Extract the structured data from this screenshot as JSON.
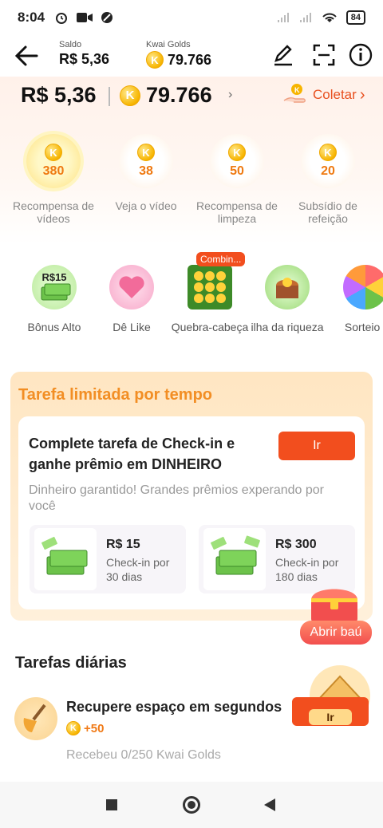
{
  "status_bar": {
    "time": "8:04",
    "battery": "84"
  },
  "header": {
    "saldo_label": "Saldo",
    "saldo_value": "R$ 5,36",
    "golds_label": "Kwai Golds",
    "golds_value": "79.766"
  },
  "hero": {
    "money": "R$ 5,36",
    "golds": "79.766",
    "coletar_label": "Coletar"
  },
  "rewards": [
    {
      "amount": "380",
      "label": "Recompensa de vídeos",
      "highlight": true
    },
    {
      "amount": "38",
      "label": "Veja o vídeo",
      "highlight": false
    },
    {
      "amount": "50",
      "label": "Recompensa de limpeza",
      "highlight": false
    },
    {
      "amount": "20",
      "label": "Subsídio de refeição",
      "highlight": false
    }
  ],
  "activities": [
    {
      "label": "Bônus Alto",
      "badge": "R$15"
    },
    {
      "label": "Dê Like"
    },
    {
      "label": "Quebra-cabeça",
      "badge": "Combin..."
    },
    {
      "label": "ilha da riqueza"
    },
    {
      "label": "Sorteio I"
    }
  ],
  "limited": {
    "title": "Tarefa limitada por tempo",
    "task_title": "Complete tarefa de Check-in e ganhe prêmio em DINHEIRO",
    "button": "Ir",
    "subtitle": "Dinheiro garantido! Grandes prêmios experando por você",
    "prizes": [
      {
        "value": "R$ 15",
        "desc": "Check-in por 30 dias"
      },
      {
        "value": "R$ 300",
        "desc": "Check-in por 180 dias"
      }
    ]
  },
  "chest": {
    "label": "Abrir baú"
  },
  "daily": {
    "title": "Tarefas diárias",
    "items": [
      {
        "title": "Recupere espaço em segundos",
        "reward": "+50",
        "progress": "Recebeu 0/250 Kwai Golds",
        "button": "Ir"
      }
    ]
  },
  "colors": {
    "accent": "#f24e1e",
    "gold": "#f7b500",
    "orange_title": "#f28e24"
  }
}
